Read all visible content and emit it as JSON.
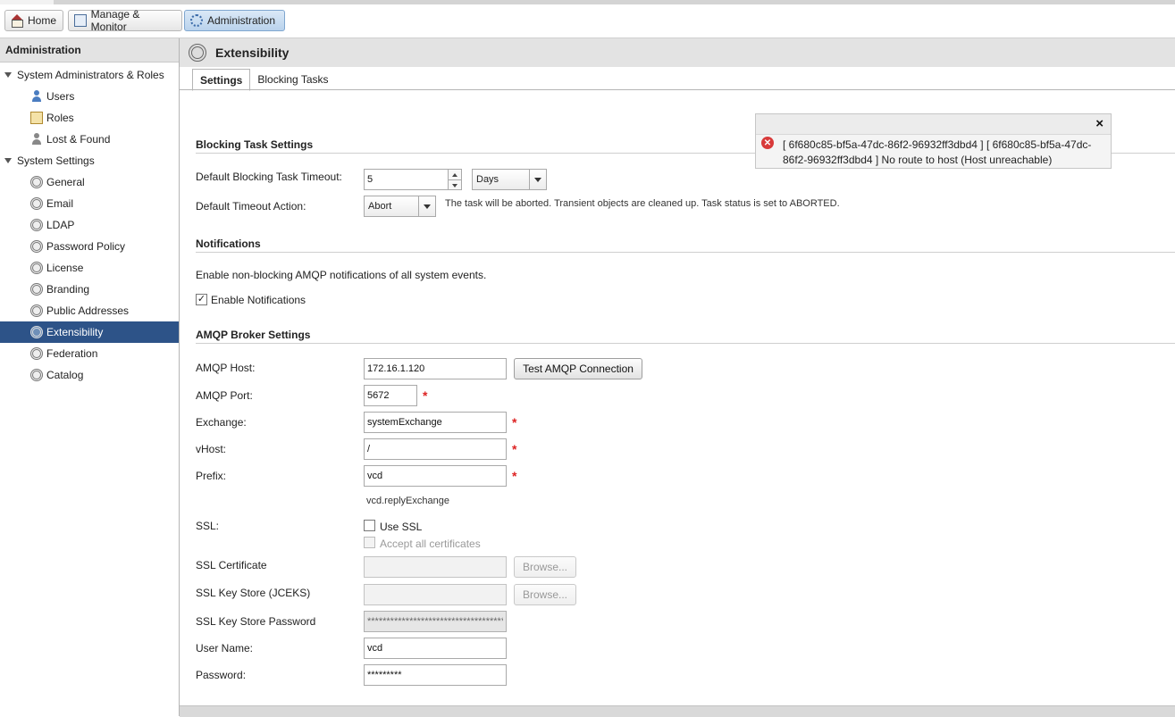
{
  "nav": {
    "home": "Home",
    "manage": "Manage & Monitor",
    "admin": "Administration"
  },
  "sidebar": {
    "header": "Administration",
    "groups": [
      {
        "label": "System Administrators & Roles",
        "items": [
          "Users",
          "Roles",
          "Lost & Found"
        ]
      },
      {
        "label": "System Settings",
        "items": [
          "General",
          "Email",
          "LDAP",
          "Password Policy",
          "License",
          "Branding",
          "Public Addresses",
          "Extensibility",
          "Federation",
          "Catalog"
        ]
      }
    ],
    "selected": "Extensibility"
  },
  "page": {
    "title": "Extensibility",
    "tabs": [
      "Settings",
      "Blocking Tasks"
    ],
    "active_tab": "Settings"
  },
  "blocking": {
    "section": "Blocking Task Settings",
    "timeout_label": "Default Blocking Task Timeout:",
    "timeout_value": "5",
    "timeout_unit": "Days",
    "action_label": "Default Timeout Action:",
    "action_value": "Abort",
    "action_hint": "The task will be aborted. Transient objects are cleaned up. Task status is set to ABORTED."
  },
  "notifications": {
    "section": "Notifications",
    "description": "Enable non-blocking AMQP notifications of all system events.",
    "enable_label": "Enable Notifications",
    "enabled": true
  },
  "amqp": {
    "section": "AMQP Broker Settings",
    "host_label": "AMQP Host:",
    "host_value": "172.16.1.120",
    "test_button": "Test AMQP Connection",
    "port_label": "AMQP Port:",
    "port_value": "5672",
    "exchange_label": "Exchange:",
    "exchange_value": "systemExchange",
    "vhost_label": "vHost:",
    "vhost_value": "/",
    "prefix_label": "Prefix:",
    "prefix_value": "vcd",
    "prefix_preview": "vcd.replyExchange",
    "ssl_label": "SSL:",
    "use_ssl": "Use SSL",
    "accept_all": "Accept all certificates",
    "cert_label": "SSL Certificate",
    "keystore_label": "SSL Key Store (JCEKS)",
    "browse": "Browse...",
    "keystore_pw_label": "SSL Key Store Password",
    "keystore_pw_value": "************************************",
    "user_label": "User Name:",
    "user_value": "vcd",
    "password_label": "Password:",
    "password_value": "*********",
    "required_mark": "*"
  },
  "toast": {
    "close": "×",
    "message": "[ 6f680c85-bf5a-47dc-86f2-96932ff3dbd4 ] [ 6f680c85-bf5a-47dc-86f2-96932ff3dbd4 ] No route to host (Host unreachable)",
    "error_color": "#d83a3a"
  }
}
